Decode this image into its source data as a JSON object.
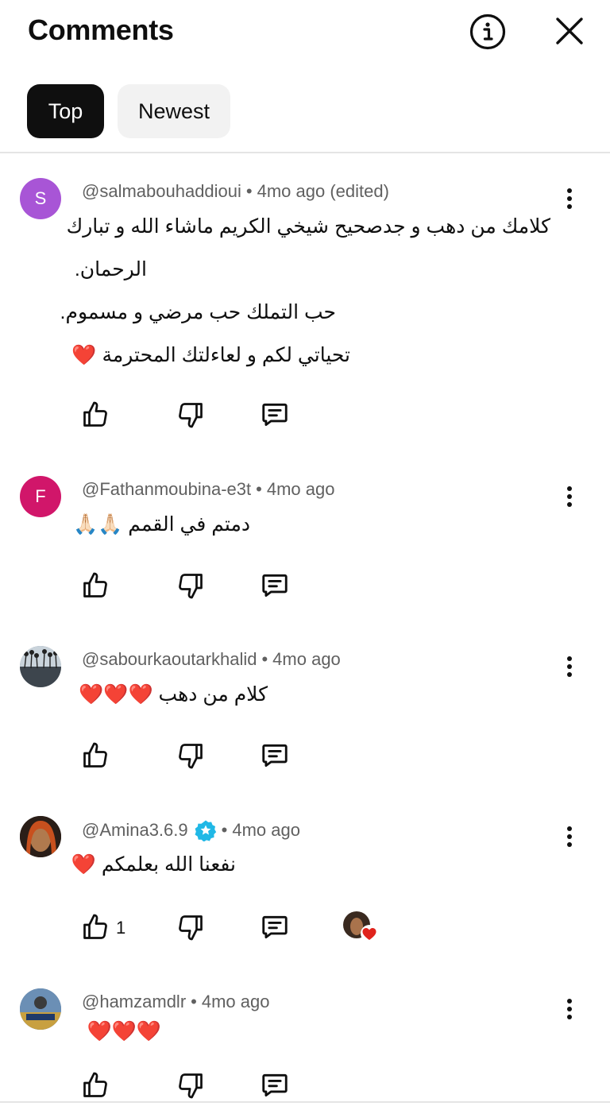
{
  "header": {
    "title": "Comments",
    "info_icon": "info-circle-icon",
    "close_icon": "close-icon"
  },
  "chips": [
    {
      "label": "Top",
      "selected": true
    },
    {
      "label": "Newest",
      "selected": false
    }
  ],
  "comments": [
    {
      "author": "@salmabouhaddioui",
      "time": "4mo ago (edited)",
      "avatar_letter": "S",
      "avatar_color": "#a855d6",
      "lines": [
        "كلامك من دهب و جدصحيح شيخي الكريم ماشاء الله و تبارك",
        "الرحمان.",
        "حب التملك حب مرضي و مسموم.",
        "تحياتي لكم و لعاءلتك المحترمة ❤️"
      ]
    },
    {
      "author": "@Fathanmoubina-e3t",
      "time": "4mo ago",
      "avatar_letter": "F",
      "avatar_color": "#d1166a",
      "lines": [
        "دمتم في القمم 🙏🏻🙏🏻"
      ]
    },
    {
      "author": "@sabourkaoutarkhalid",
      "time": "4mo ago",
      "avatar_letter": "",
      "avatar_color": "#6d7b86",
      "lines": [
        "كلام من دهب ❤️❤️❤️"
      ]
    },
    {
      "author": "@Amina3.6.9",
      "time": "4mo ago",
      "avatar_letter": "",
      "avatar_color": "#3b2a22",
      "verified": true,
      "lines": [
        "نفعنا الله بعلمكم ❤️"
      ],
      "like_count": "1",
      "creator_heart": true
    },
    {
      "author": "@hamzamdlr",
      "time": "4mo ago",
      "avatar_letter": "",
      "avatar_color": "#4a6a8c",
      "lines": [
        "❤️❤️❤️"
      ]
    }
  ],
  "colors": {
    "meta_text": "#606060",
    "verified_badge": "#20b8e6",
    "heart": "#e0231c"
  }
}
